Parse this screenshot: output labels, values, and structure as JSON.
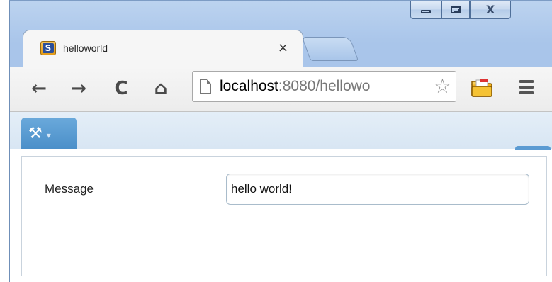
{
  "browser": {
    "tab": {
      "favicon_letter": "S",
      "title": "helloworld",
      "close_glyph": "×"
    },
    "url": {
      "host": "localhost",
      "rest": ":8080/hellowo"
    },
    "nav": {
      "back_glyph": "←",
      "forward_glyph": "→",
      "reload_glyph": "C",
      "home_glyph": "⌂"
    },
    "icons": {
      "star": "☆",
      "window_close": "X"
    }
  },
  "devtools": {
    "tools_glyph": "⚒",
    "caret_glyph": "▾",
    "accent_color": "#5b9bd2"
  },
  "form": {
    "message_label": "Message",
    "message_value": "hello world!"
  }
}
